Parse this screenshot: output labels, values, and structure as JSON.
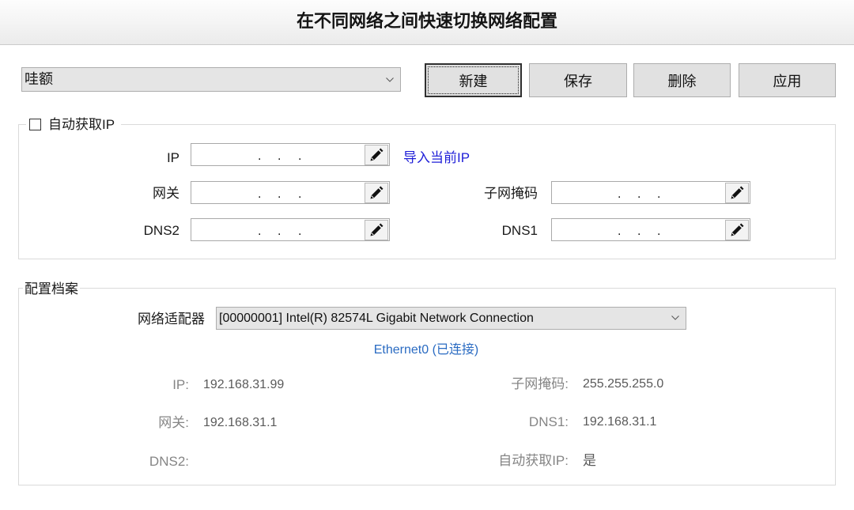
{
  "window": {
    "title": "在不同网络之间快速切换网络配置"
  },
  "toolbar": {
    "profile_select": "哇额",
    "buttons": {
      "new": "新建",
      "save": "保存",
      "delete": "删除",
      "apply": "应用"
    }
  },
  "manual": {
    "auto_ip": {
      "label": "自动获取IP",
      "checked": false
    },
    "separator": ".",
    "ip_label": "IP",
    "import_link": "导入当前IP",
    "gateway_label": "网关",
    "subnet_label": "子网掩码",
    "dns2_label": "DNS2",
    "dns1_label": "DNS1"
  },
  "profile": {
    "legend": "配置档案",
    "adapter_label": "网络适配器",
    "adapter_value": "[00000001] Intel(R) 82574L Gigabit Network Connection",
    "status": "Ethernet0 (已连接)",
    "fields": {
      "ip": {
        "label": "IP:",
        "value": "192.168.31.99"
      },
      "subnet": {
        "label": "子网掩码:",
        "value": "255.255.255.0"
      },
      "gateway": {
        "label": "网关:",
        "value": "192.168.31.1"
      },
      "dns1": {
        "label": "DNS1:",
        "value": "192.168.31.1"
      },
      "dns2": {
        "label": "DNS2:",
        "value": ""
      },
      "auto_ip": {
        "label": "自动获取IP:",
        "value": "是"
      }
    }
  },
  "icons": {
    "dropdown": "chevron-down-icon",
    "edit": "pencil-icon",
    "checkbox": "checkbox-unchecked"
  },
  "colors": {
    "link": "#1f1fd8",
    "status": "#2a6bc2",
    "info_label": "#858585",
    "info_value": "#5a5a5a"
  }
}
